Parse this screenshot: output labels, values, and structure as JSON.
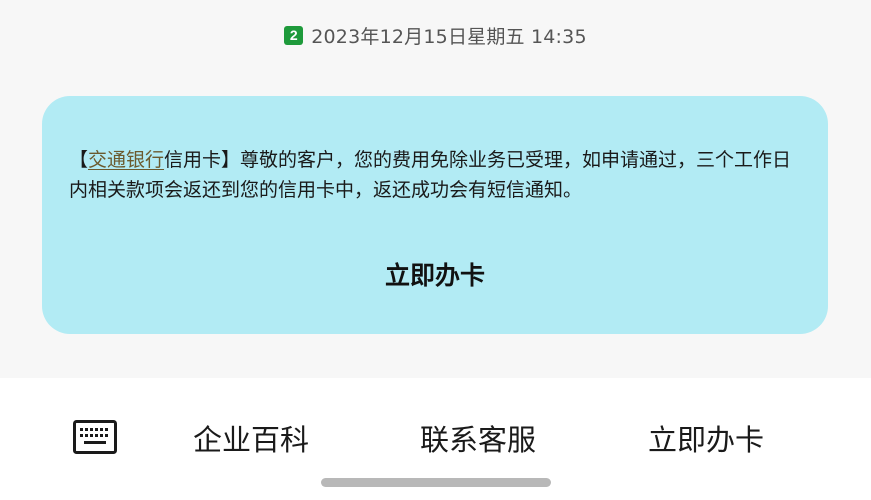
{
  "message": {
    "sim_slot": "2",
    "timestamp": "2023年12月15日星期五 14:35",
    "body_prefix": "【",
    "body_link": "交通银行",
    "body_text": "信用卡】尊敬的客户，您的费用免除业务已受理，如申请通过，三个工作日内相关款项会返还到您的信用卡中，返还成功会有短信通知。",
    "action_label": "立即办卡",
    "bubble_color": "#b2ebf4",
    "link_color": "#6b5a2e"
  },
  "menu": {
    "keyboard_icon": "keyboard-icon",
    "items": [
      {
        "label": "企业百科"
      },
      {
        "label": "联系客服"
      },
      {
        "label": "立即办卡"
      }
    ]
  }
}
